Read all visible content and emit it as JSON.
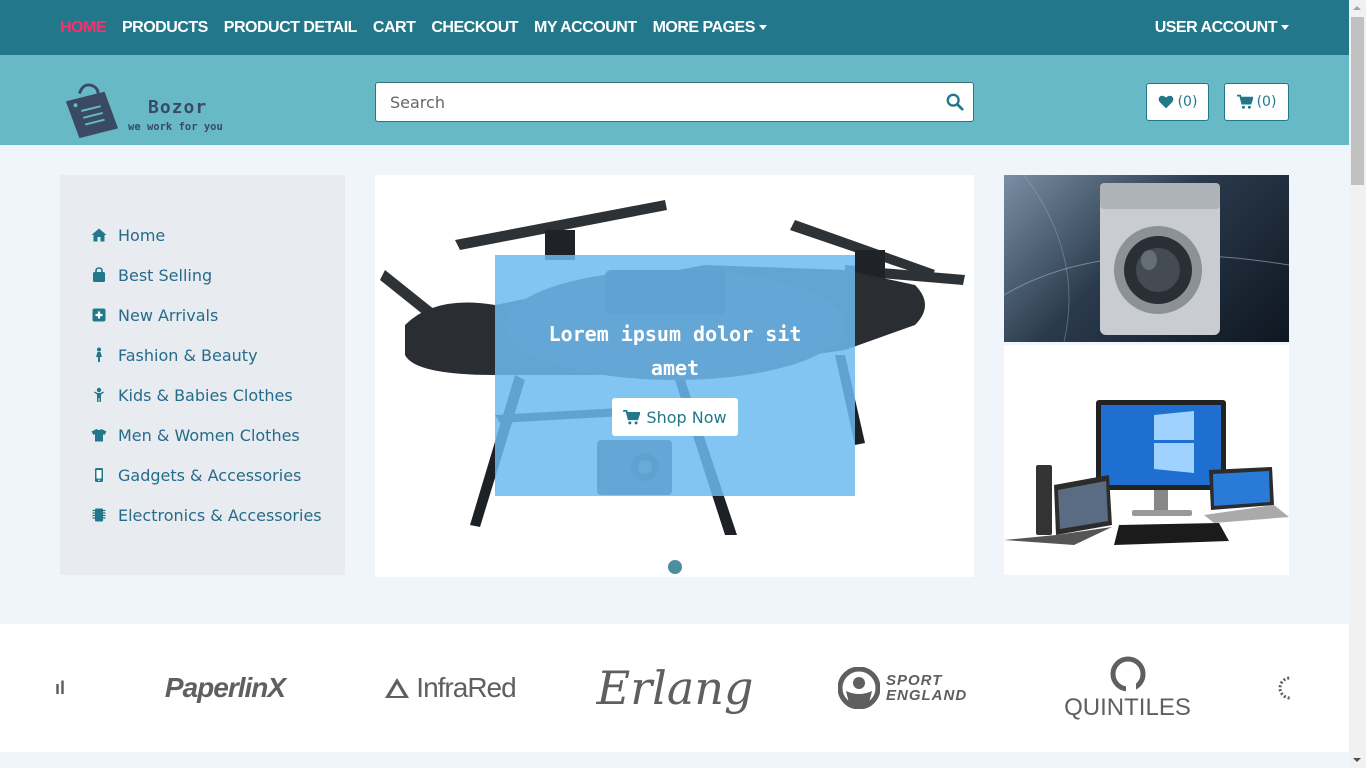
{
  "topnav": {
    "items": [
      {
        "label": "HOME",
        "active": true
      },
      {
        "label": "PRODUCTS"
      },
      {
        "label": "PRODUCT DETAIL"
      },
      {
        "label": "CART"
      },
      {
        "label": "CHECKOUT"
      },
      {
        "label": "MY ACCOUNT"
      },
      {
        "label": "MORE PAGES"
      }
    ],
    "user_account": "USER ACCOUNT",
    "active_color": "#ff2d6b",
    "background": "#22788a"
  },
  "header": {
    "logo_title": "Bozor",
    "logo_subtitle": "we work for you",
    "search_placeholder": "Search",
    "wishlist_count": "(0)",
    "cart_count": "(0)",
    "background": "#67b9c6"
  },
  "sidebar": {
    "items": [
      {
        "label": "Home",
        "icon": "home-icon"
      },
      {
        "label": "Best Selling",
        "icon": "shopping-bag-icon"
      },
      {
        "label": "New Arrivals",
        "icon": "plus-square-icon"
      },
      {
        "label": "Fashion & Beauty",
        "icon": "female-icon"
      },
      {
        "label": "Kids & Babies Clothes",
        "icon": "child-icon"
      },
      {
        "label": "Men & Women Clothes",
        "icon": "tshirt-icon"
      },
      {
        "label": "Gadgets & Accessories",
        "icon": "mobile-icon"
      },
      {
        "label": "Electronics & Accessories",
        "icon": "microchip-icon"
      }
    ]
  },
  "slider": {
    "caption": "Lorem ipsum dolor sit amet",
    "button_label": "Shop Now"
  },
  "brands": {
    "items": [
      "PaperlinX",
      "InfraRed",
      "Erlang",
      "SPORT ENGLAND",
      "QUINTILES"
    ]
  }
}
